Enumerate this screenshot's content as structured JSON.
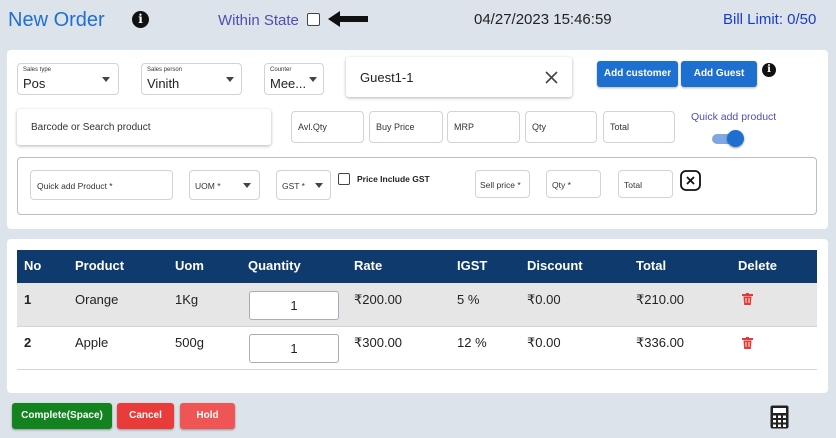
{
  "header": {
    "title": "New Order",
    "within_state_label": "Within State",
    "datetime": "04/27/2023 15:46:59",
    "bill_limit": "Bill Limit: 0/50",
    "info_glyph": "i"
  },
  "order_form": {
    "sales_type": {
      "label": "Sales type",
      "value": "Pos"
    },
    "sales_person": {
      "label": "Sales person",
      "value": "Vinith"
    },
    "counter": {
      "label": "Counter",
      "value": "Mee..."
    },
    "customer": {
      "value": "Guest1-1"
    },
    "add_customer_label": "Add customer",
    "add_guest_label": "Add Guest",
    "barcode_placeholder": "Barcode or Search product",
    "avl_qty_placeholder": "Avl.Qty",
    "buy_price_placeholder": "Buy Price",
    "mrp_placeholder": "MRP",
    "qty_placeholder": "Qty",
    "total_placeholder": "Total",
    "quick_add_product_label": "Quick add product",
    "quick_add_toggle_on": true
  },
  "quick_add": {
    "product_placeholder": "Quick add Product *",
    "uom_placeholder": "UOM *",
    "gst_placeholder": "GST *",
    "price_include_gst_label": "Price Include GST",
    "sell_price_placeholder": "Sell price *",
    "qty_placeholder": "Qty *",
    "total_placeholder": "Total"
  },
  "table": {
    "columns": [
      "No",
      "Product",
      "Uom",
      "Quantity",
      "Rate",
      "IGST",
      "Discount",
      "Total",
      "Delete"
    ],
    "rows": [
      {
        "no": "1",
        "product": "Orange",
        "uom": "1Kg",
        "quantity": "1",
        "rate": "₹200.00",
        "igst": "5 %",
        "discount": "₹0.00",
        "total": "₹210.00"
      },
      {
        "no": "2",
        "product": "Apple",
        "uom": "500g",
        "quantity": "1",
        "rate": "₹300.00",
        "igst": "12 %",
        "discount": "₹0.00",
        "total": "₹336.00"
      }
    ]
  },
  "footer": {
    "complete_label": "Complete(Space)",
    "cancel_label": "Cancel",
    "hold_label": "Hold"
  },
  "icons": {
    "info": "info-icon",
    "arrow": "arrow-left-icon",
    "clear": "close-icon",
    "delete": "trash-icon",
    "calculator": "calculator-icon"
  },
  "colors": {
    "title_blue": "#1f6fd1",
    "button_blue": "#1d6fd0",
    "table_header": "#0e3a6e",
    "complete_green": "#12831f",
    "cancel_red": "#ea3b3b",
    "hold_red": "#f05555",
    "delete_red": "#e53935"
  }
}
